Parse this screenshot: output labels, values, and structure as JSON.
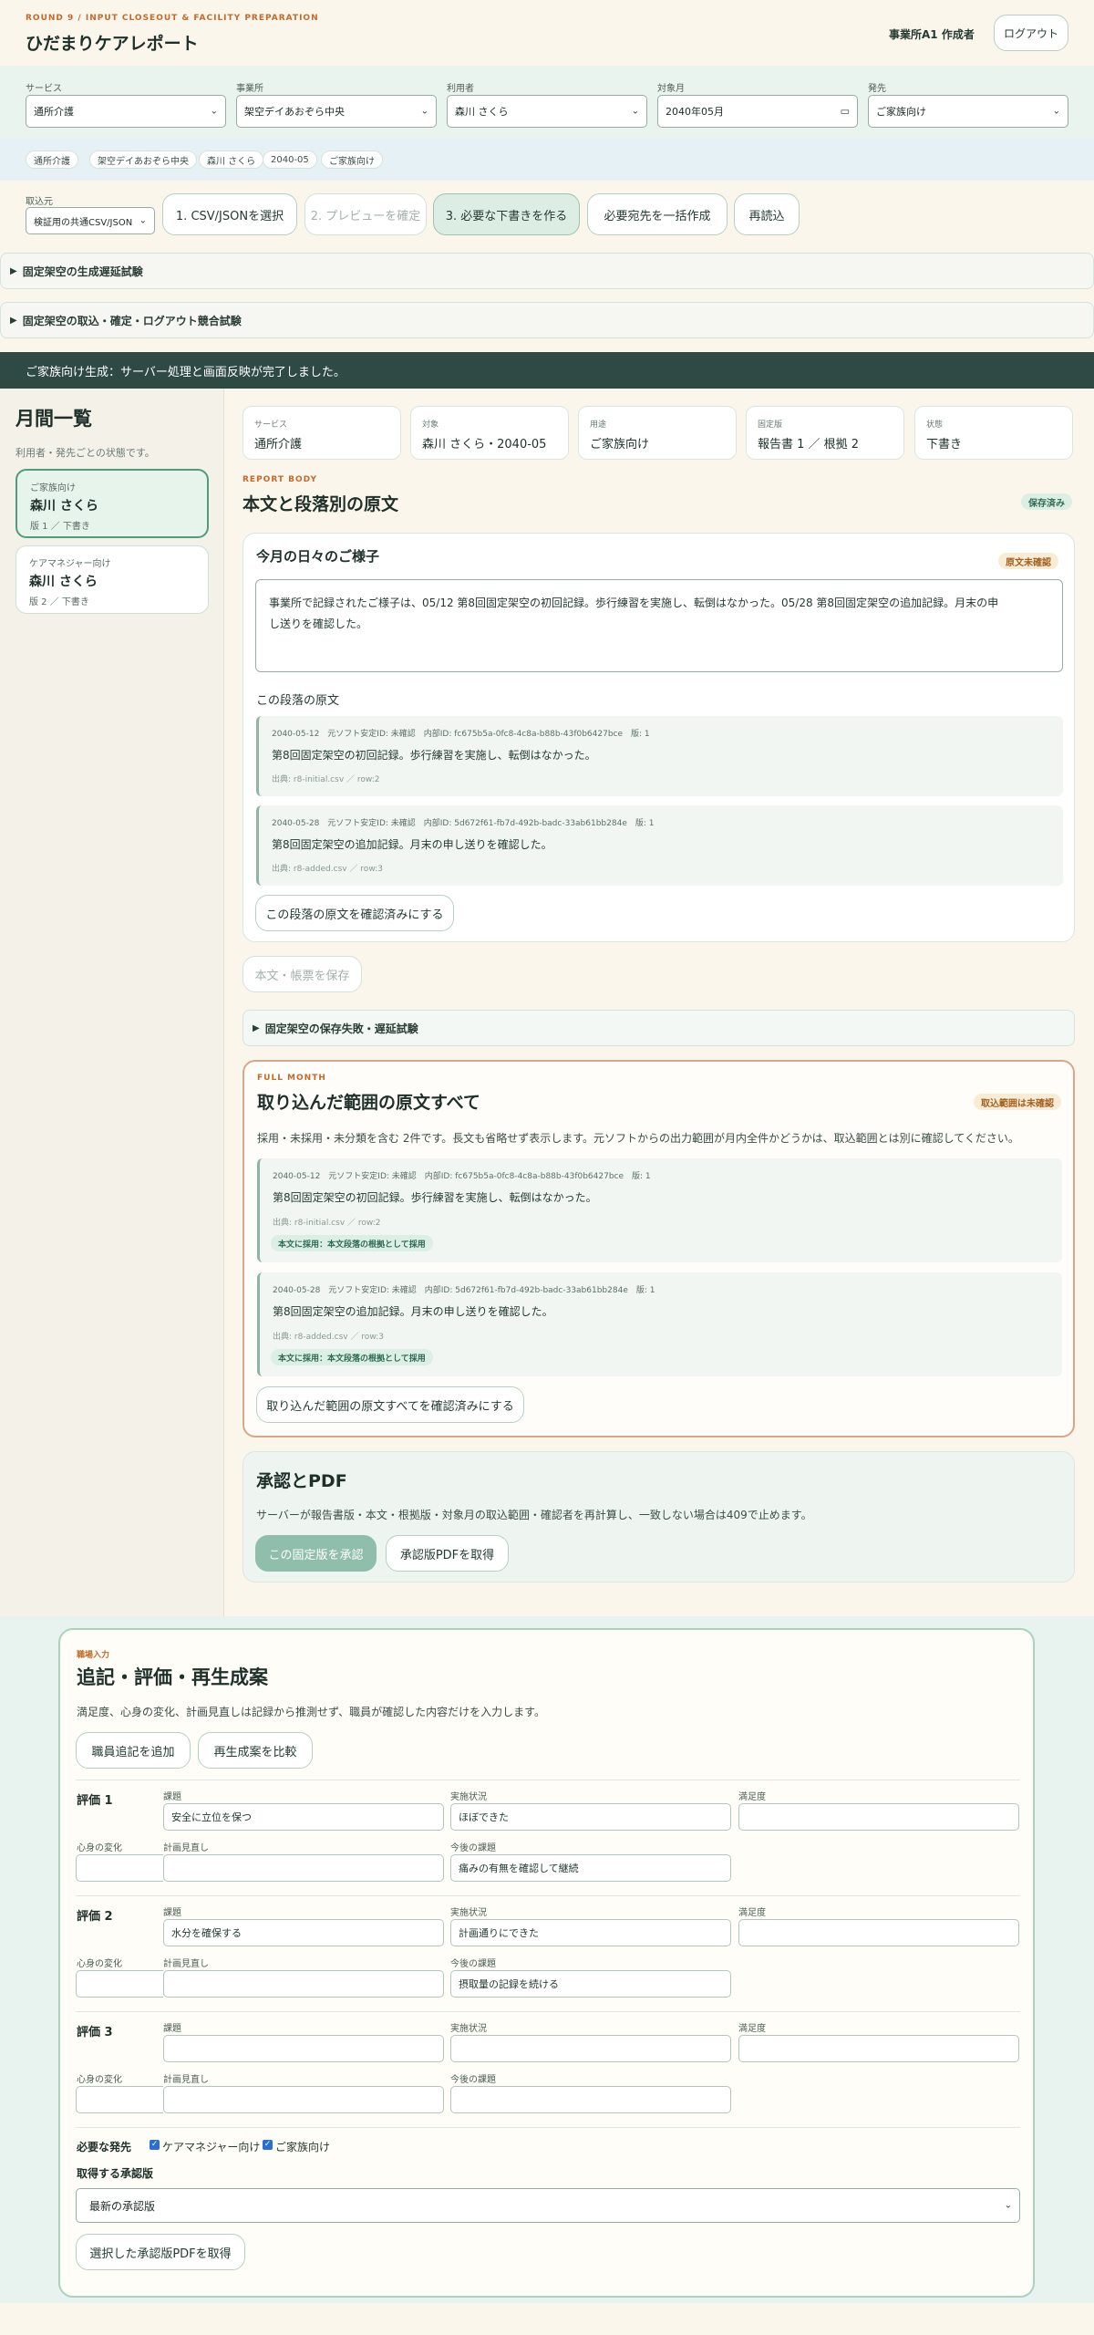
{
  "header": {
    "round": "ROUND 9 / INPUT CLOSEOUT & FACILITY PREPARATION",
    "title": "ひだまりケアレポート",
    "user": "事業所A1 作成者",
    "logout": "ログアウト"
  },
  "filters": {
    "service": {
      "label": "サービス",
      "value": "通所介護"
    },
    "facility": {
      "label": "事業所",
      "value": "架空デイあおぞら中央"
    },
    "client": {
      "label": "利用者",
      "value": "森川 さくら"
    },
    "month": {
      "label": "対象月",
      "value": "2040年05月"
    },
    "recipient": {
      "label": "発先",
      "value": "ご家族向け"
    }
  },
  "chips": [
    "通所介護",
    "架空デイあおぞら中央",
    "森川 さくら",
    "2040-05",
    "ご家族向け"
  ],
  "import": {
    "label": "取込元",
    "source_value": "検証用の共通CSV/JSON",
    "buttons": [
      "1. CSV/JSONを選択",
      "2. プレビューを確定",
      "3. 必要な下書きを作る",
      "必要宛先を一括作成",
      "再読込"
    ]
  },
  "details": {
    "d1": "固定架空の生成遅延試験",
    "d2": "固定架空の取込・確定・ログアウト競合試験",
    "d3": "固定架空の保存失敗・遅延試験"
  },
  "banner": "ご家族向け生成：サーバー処理と画面反映が完了しました。",
  "sidebar": {
    "title": "月間一覧",
    "subtitle": "利用者・発先ごとの状態です。",
    "items": [
      {
        "type": "ご家族向け",
        "name": "森川 さくら",
        "ver": "版 1 ／ 下書き"
      },
      {
        "type": "ケアマネジャー向け",
        "name": "森川 さくら",
        "ver": "版 2 ／ 下書き"
      }
    ]
  },
  "info": [
    {
      "label": "サービス",
      "value": "通所介護"
    },
    {
      "label": "対象",
      "value": "森川 さくら・2040-05"
    },
    {
      "label": "用途",
      "value": "ご家族向け"
    },
    {
      "label": "固定版",
      "value": "報告書 1 ／ 根拠 2"
    },
    {
      "label": "状態",
      "value": "下書き"
    }
  ],
  "report": {
    "kicker": "REPORT BODY",
    "title": "本文と段落別の原文",
    "saved": "保存済み",
    "para_title": "今月の日々のご様子",
    "para_status": "原文未確認",
    "body_line1": "事業所で記録されたご様子は、05/12 第8回固定架空の初回記録。歩行練習を実施し、転倒はなかった。05/28 第8回固定架空の追加記録。月末の申",
    "body_line2": "し送りを確認した。",
    "sources_title": "この段落の原文",
    "confirm_btn": "この段落の原文を確認済みにする",
    "save_btn": "本文・帳票を保存"
  },
  "sources": [
    {
      "meta": "2040-05-12　元ソフト安定ID: 未確認　内部ID: fc675b5a-0fc8-4c8a-b88b-43f0b6427bce　版: 1",
      "text": "第8回固定架空の初回記録。歩行練習を実施し、転倒はなかった。",
      "file": "出典: r8-initial.csv ／ row:2",
      "tag": "本文に採用：本文段落の根拠として採用"
    },
    {
      "meta": "2040-05-28　元ソフト安定ID: 未確認　内部ID: 5d672f61-fb7d-492b-badc-33ab61bb284e　版: 1",
      "text": "第8回固定架空の追加記録。月末の申し送りを確認した。",
      "file": "出典: r8-added.csv ／ row:3",
      "tag": "本文に採用：本文段落の根拠として採用"
    }
  ],
  "fullmonth": {
    "kicker": "FULL MONTH",
    "title": "取り込んだ範囲の原文すべて",
    "status": "取込範囲は未確認",
    "desc": "採用・未採用・未分類を含む 2件です。長文も省略せず表示します。元ソフトからの出力範囲が月内全件かどうかは、取込範囲とは別に確認してください。",
    "confirm_btn": "取り込んだ範囲の原文すべてを確認済みにする"
  },
  "approval": {
    "title": "承認とPDF",
    "desc": "サーバーが報告書版・本文・根拠版・対象月の取込範囲・確認者を再計算し、一致しない場合は409で止めます。",
    "approve_btn": "この固定版を承認",
    "pdf_btn": "承認版PDFを取得"
  },
  "field_input": {
    "kicker": "職場入力",
    "title": "追記・評価・再生成案",
    "desc": "満足度、心身の変化、計画見直しは記録から推測せず、職員が確認した内容だけを入力します。",
    "add_btn": "職員追記を追加",
    "compare_btn": "再生成案を比較",
    "labels": {
      "issue": "課題",
      "status": "実施状況",
      "satisfaction": "満足度",
      "change": "心身の変化",
      "plan": "計画見直し",
      "next": "今後の課題"
    },
    "evals": [
      {
        "title": "評価 1",
        "issue": "安全に立位を保つ",
        "status": "ほぼできた",
        "satisfaction": "",
        "change": "",
        "plan": "",
        "next": "痛みの有無を確認して継続"
      },
      {
        "title": "評価 2",
        "issue": "水分を確保する",
        "status": "計画通りにできた",
        "satisfaction": "",
        "change": "",
        "plan": "",
        "next": "摂取量の記録を続ける"
      },
      {
        "title": "評価 3",
        "issue": "",
        "status": "",
        "satisfaction": "",
        "change": "",
        "plan": "",
        "next": ""
      }
    ],
    "req_label": "必要な発先",
    "req_opts": [
      "ケアマネジャー向け",
      "ご家族向け"
    ],
    "ver_label": "取得する承認版",
    "ver_value": "最新の承認版",
    "get_btn": "選択した承認版PDFを取得"
  },
  "colors": {
    "accent": "#2f6b54",
    "banner": "#2f4a42",
    "kicker": "#c26a2a"
  }
}
